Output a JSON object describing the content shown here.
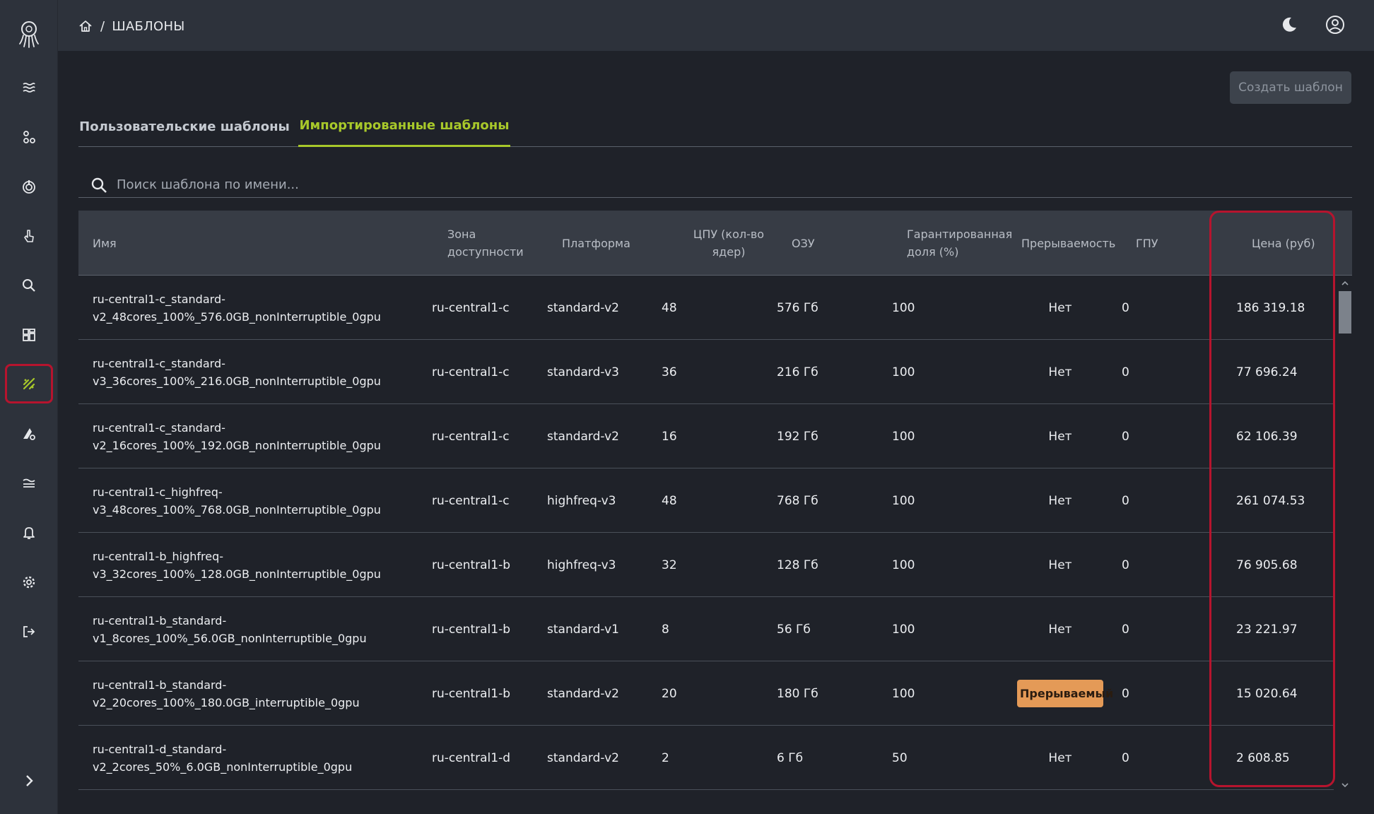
{
  "breadcrumb": {
    "separator": "/",
    "current": "ШАБЛОНЫ"
  },
  "toolbar": {
    "create_label": "Создать шаблон"
  },
  "tabs": [
    {
      "label": "Пользовательские шаблоны",
      "active": false
    },
    {
      "label": "Импортированные шаблоны",
      "active": true
    }
  ],
  "search": {
    "placeholder": "Поиск шаблона по имени...",
    "value": ""
  },
  "table": {
    "headers": {
      "name": "Имя",
      "zone": "Зона доступности",
      "platform": "Платформа",
      "cpu": "ЦПУ (кол-во ядер)",
      "ram": "ОЗУ",
      "guaranteed": "Гарантированная доля (%)",
      "interruptible": "Прерываемость",
      "gpu": "ГПУ",
      "price": "Цена (руб)"
    },
    "rows": [
      {
        "name_line1": "ru-central1-c_standard-",
        "name_line2": "v2_48cores_100%_576.0GB_nonInterruptible_0gpu",
        "zone": "ru-central1-c",
        "platform": "standard-v2",
        "cpu": "48",
        "ram": "576 Гб",
        "guaranteed": "100",
        "interruptible": "Нет",
        "gpu": "0",
        "price": "186 319.18"
      },
      {
        "name_line1": "ru-central1-c_standard-",
        "name_line2": "v3_36cores_100%_216.0GB_nonInterruptible_0gpu",
        "zone": "ru-central1-c",
        "platform": "standard-v3",
        "cpu": "36",
        "ram": "216 Гб",
        "guaranteed": "100",
        "interruptible": "Нет",
        "gpu": "0",
        "price": "77 696.24"
      },
      {
        "name_line1": "ru-central1-c_standard-",
        "name_line2": "v2_16cores_100%_192.0GB_nonInterruptible_0gpu",
        "zone": "ru-central1-c",
        "platform": "standard-v2",
        "cpu": "16",
        "ram": "192 Гб",
        "guaranteed": "100",
        "interruptible": "Нет",
        "gpu": "0",
        "price": "62 106.39"
      },
      {
        "name_line1": "ru-central1-c_highfreq-",
        "name_line2": "v3_48cores_100%_768.0GB_nonInterruptible_0gpu",
        "zone": "ru-central1-c",
        "platform": "highfreq-v3",
        "cpu": "48",
        "ram": "768 Гб",
        "guaranteed": "100",
        "interruptible": "Нет",
        "gpu": "0",
        "price": "261 074.53"
      },
      {
        "name_line1": "ru-central1-b_highfreq-",
        "name_line2": "v3_32cores_100%_128.0GB_nonInterruptible_0gpu",
        "zone": "ru-central1-b",
        "platform": "highfreq-v3",
        "cpu": "32",
        "ram": "128 Гб",
        "guaranteed": "100",
        "interruptible": "Нет",
        "gpu": "0",
        "price": "76 905.68"
      },
      {
        "name_line1": "ru-central1-b_standard-",
        "name_line2": "v1_8cores_100%_56.0GB_nonInterruptible_0gpu",
        "zone": "ru-central1-b",
        "platform": "standard-v1",
        "cpu": "8",
        "ram": "56 Гб",
        "guaranteed": "100",
        "interruptible": "Нет",
        "gpu": "0",
        "price": "23 221.97"
      },
      {
        "name_line1": "ru-central1-b_standard-",
        "name_line2": "v2_20cores_100%_180.0GB_interruptible_0gpu",
        "zone": "ru-central1-b",
        "platform": "standard-v2",
        "cpu": "20",
        "ram": "180 Гб",
        "guaranteed": "100",
        "interruptible": "Прерываемый",
        "interruptible_badge": true,
        "gpu": "0",
        "price": "15 020.64"
      },
      {
        "name_line1": "ru-central1-d_standard-",
        "name_line2": "v2_2cores_50%_6.0GB_nonInterruptible_0gpu",
        "zone": "ru-central1-d",
        "platform": "standard-v2",
        "cpu": "2",
        "ram": "6 Гб",
        "guaranteed": "50",
        "interruptible": "Нет",
        "gpu": "0",
        "price": "2 608.85"
      }
    ]
  },
  "sidebar": {
    "items": [
      {
        "icon": "waves-icon"
      },
      {
        "icon": "nodes-icon"
      },
      {
        "icon": "power-icon"
      },
      {
        "icon": "pointer-icon"
      },
      {
        "icon": "search-icon"
      },
      {
        "icon": "dashboard-icon"
      },
      {
        "icon": "templates-icon",
        "active": true
      },
      {
        "icon": "deploy-settings-icon"
      },
      {
        "icon": "layers-icon"
      },
      {
        "icon": "bell-icon"
      },
      {
        "icon": "gear-icon"
      },
      {
        "icon": "logout-icon"
      }
    ],
    "expand_icon": "chevron-right-icon"
  },
  "colors": {
    "accent": "#a8c82a",
    "highlight": "#b6142e",
    "badge": "#e49a57",
    "background": "#1f2229",
    "panel": "#2d323b"
  }
}
